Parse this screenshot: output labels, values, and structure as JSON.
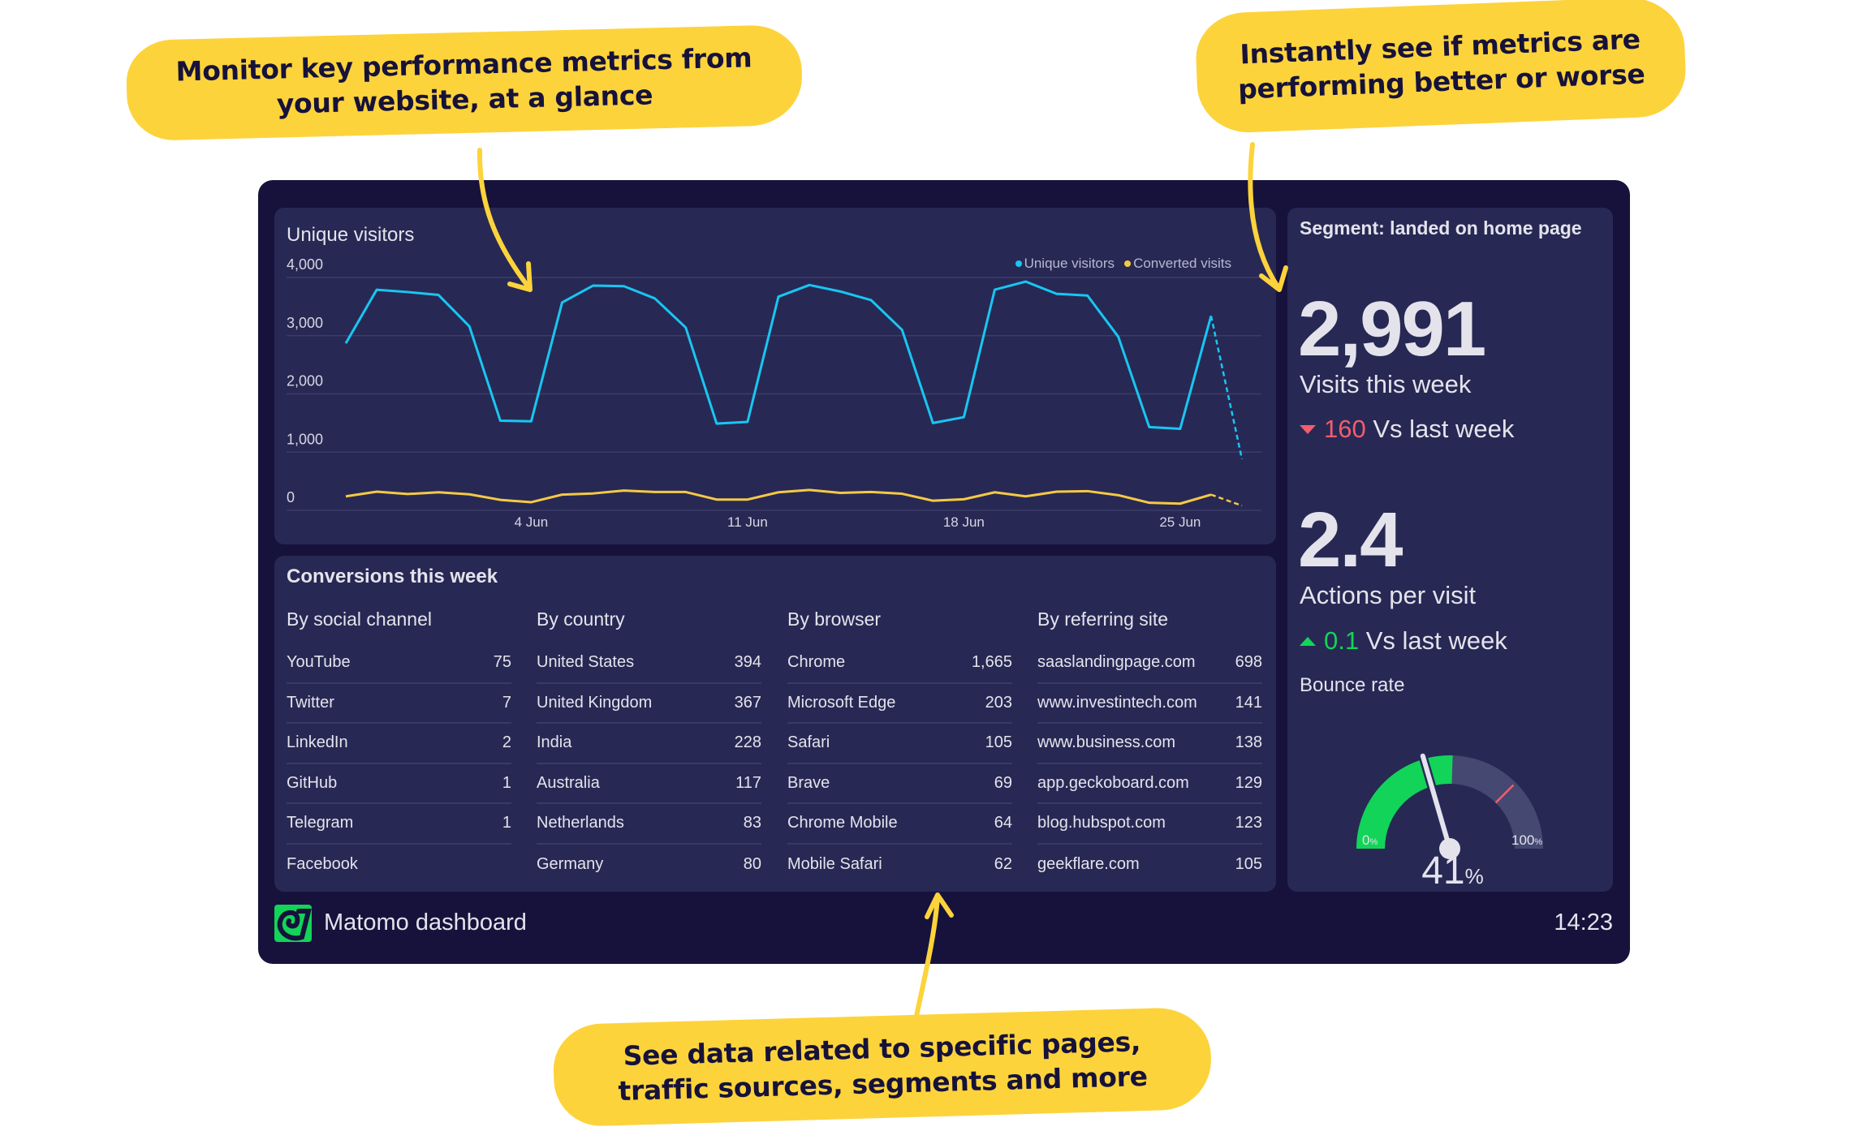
{
  "callouts": {
    "top_left": "Monitor key performance metrics from your website, at a glance",
    "top_right": "Instantly see if metrics are performing better or worse",
    "bottom": "See data related to specific pages, traffic sources, segments and more"
  },
  "colors": {
    "frame_bg": "#17123b",
    "panel_bg": "#272954",
    "unique_visitors": "#19c6f2",
    "converted_visits": "#f5c945",
    "positive": "#12d458",
    "negative": "#f35d6c",
    "callout": "#fdd33b",
    "gauge_track": "#454871"
  },
  "chart_panel": {
    "title": "Unique visitors",
    "legend": [
      {
        "label": "Unique visitors",
        "color": "#19c6f2"
      },
      {
        "label": "Converted visits",
        "color": "#f5c945"
      }
    ]
  },
  "chart_data": {
    "type": "line",
    "title": "Unique visitors",
    "xlabel": "",
    "ylabel": "",
    "ylim": [
      0,
      4000
    ],
    "yticks": [
      "0",
      "1,000",
      "2,000",
      "3,000",
      "4,000"
    ],
    "ytick_values": [
      0,
      1000,
      2000,
      3000,
      4000
    ],
    "x": [
      1,
      2,
      3,
      4,
      5,
      6,
      7,
      8,
      9,
      10,
      11,
      12,
      13,
      14,
      15,
      16,
      17,
      18,
      19,
      20,
      21,
      22,
      23,
      24,
      25,
      26,
      27,
      28,
      29,
      30
    ],
    "xtick_labels": [
      {
        "index": 6,
        "label": "4 Jun"
      },
      {
        "index": 13,
        "label": "11 Jun"
      },
      {
        "index": 20,
        "label": "18 Jun"
      },
      {
        "index": 27,
        "label": "25 Jun"
      }
    ],
    "grid": true,
    "legend_position": "top-right",
    "dashed_last_segment": true,
    "series": [
      {
        "name": "Unique visitors",
        "color": "#19c6f2",
        "values": [
          2870,
          3790,
          3750,
          3700,
          3160,
          1540,
          1530,
          3570,
          3860,
          3850,
          3640,
          3140,
          1490,
          1520,
          3670,
          3870,
          3760,
          3610,
          3100,
          1500,
          1600,
          3790,
          3930,
          3720,
          3690,
          2980,
          1430,
          1400,
          3340,
          880
        ]
      },
      {
        "name": "Converted visits",
        "color": "#f5c945",
        "values": [
          240,
          320,
          280,
          310,
          275,
          180,
          140,
          270,
          290,
          340,
          315,
          315,
          185,
          185,
          310,
          350,
          300,
          315,
          285,
          165,
          190,
          310,
          240,
          320,
          330,
          260,
          130,
          115,
          270,
          80
        ]
      }
    ]
  },
  "conversions": {
    "title": "Conversions this week",
    "columns": [
      {
        "header": "By social channel",
        "rows": [
          {
            "label": "YouTube",
            "value": "75"
          },
          {
            "label": "Twitter",
            "value": "7"
          },
          {
            "label": "LinkedIn",
            "value": "2"
          },
          {
            "label": "GitHub",
            "value": "1"
          },
          {
            "label": "Telegram",
            "value": "1"
          },
          {
            "label": "Facebook",
            "value": ""
          }
        ]
      },
      {
        "header": "By country",
        "rows": [
          {
            "label": "United States",
            "value": "394"
          },
          {
            "label": "United Kingdom",
            "value": "367"
          },
          {
            "label": "India",
            "value": "228"
          },
          {
            "label": "Australia",
            "value": "117"
          },
          {
            "label": "Netherlands",
            "value": "83"
          },
          {
            "label": "Germany",
            "value": "80"
          }
        ]
      },
      {
        "header": "By browser",
        "rows": [
          {
            "label": "Chrome",
            "value": "1,665"
          },
          {
            "label": "Microsoft Edge",
            "value": "203"
          },
          {
            "label": "Safari",
            "value": "105"
          },
          {
            "label": "Brave",
            "value": "69"
          },
          {
            "label": "Chrome Mobile",
            "value": "64"
          },
          {
            "label": "Mobile Safari",
            "value": "62"
          }
        ]
      },
      {
        "header": "By referring site",
        "rows": [
          {
            "label": "saaslandingpage.com",
            "value": "698"
          },
          {
            "label": "www.investintech.com",
            "value": "141"
          },
          {
            "label": "www.business.com",
            "value": "138"
          },
          {
            "label": "app.geckoboard.com",
            "value": "129"
          },
          {
            "label": "blog.hubspot.com",
            "value": "123"
          },
          {
            "label": "geekflare.com",
            "value": "105"
          }
        ]
      }
    ]
  },
  "segment": {
    "title": "Segment: landed on home page",
    "visits": {
      "value": "2,991",
      "label": "Visits this week",
      "delta_value": "160",
      "delta_label": "Vs last week",
      "direction": "down"
    },
    "actions": {
      "value": "2.4",
      "label": "Actions per visit",
      "delta_value": "0.1",
      "delta_label": "Vs last week",
      "direction": "up"
    },
    "bounce": {
      "label": "Bounce rate",
      "value": 41,
      "value_text": "41",
      "unit": "%",
      "min_label": "0",
      "max_label": "100",
      "unit_small": "%",
      "green_fill_percent": 51,
      "threshold_percent": 75
    }
  },
  "footer": {
    "logo_icon": "geckoboard-logo-icon",
    "title": "Matomo dashboard",
    "time": "14:23"
  }
}
